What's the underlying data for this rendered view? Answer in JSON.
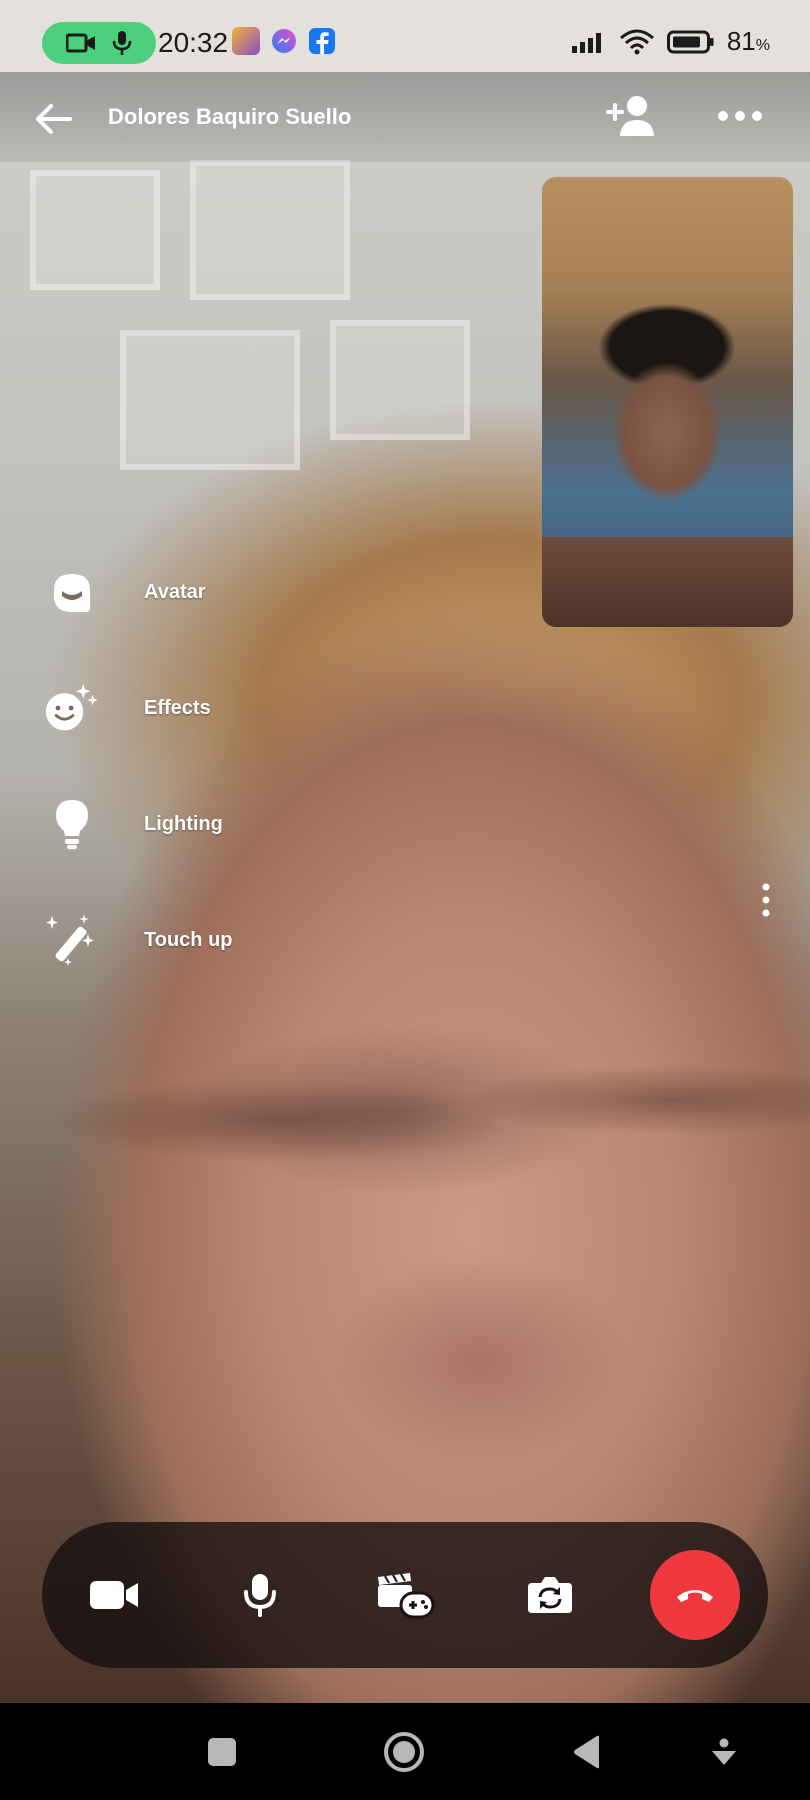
{
  "status_bar": {
    "time": "20:32",
    "battery": "81",
    "battery_unit": "%",
    "call_indicator_color": "#4cd07d",
    "icons": [
      "video-call-indicator-icon",
      "mic-indicator-icon",
      "game-app-icon",
      "messenger-icon",
      "facebook-icon",
      "signal-icon",
      "wifi-icon",
      "battery-icon"
    ]
  },
  "header": {
    "contact_name": "Dolores Baquiro Suello",
    "icons": [
      "back-arrow-icon",
      "add-person-icon",
      "more-horizontal-icon"
    ]
  },
  "side_menu": {
    "items": [
      {
        "label": "Avatar",
        "icon": "avatar-icon"
      },
      {
        "label": "Effects",
        "icon": "effects-icon"
      },
      {
        "label": "Lighting",
        "icon": "lightbulb-icon"
      },
      {
        "label": "Touch up",
        "icon": "magic-wand-icon"
      }
    ]
  },
  "controls": {
    "icons": [
      "camera-icon",
      "microphone-icon",
      "activities-icon",
      "flip-camera-icon",
      "end-call-icon"
    ],
    "end_call_color": "#f0393f"
  },
  "nav_bar": {
    "icons": [
      "recents-square-icon",
      "home-circle-icon",
      "back-triangle-icon",
      "assistant-icon"
    ]
  }
}
